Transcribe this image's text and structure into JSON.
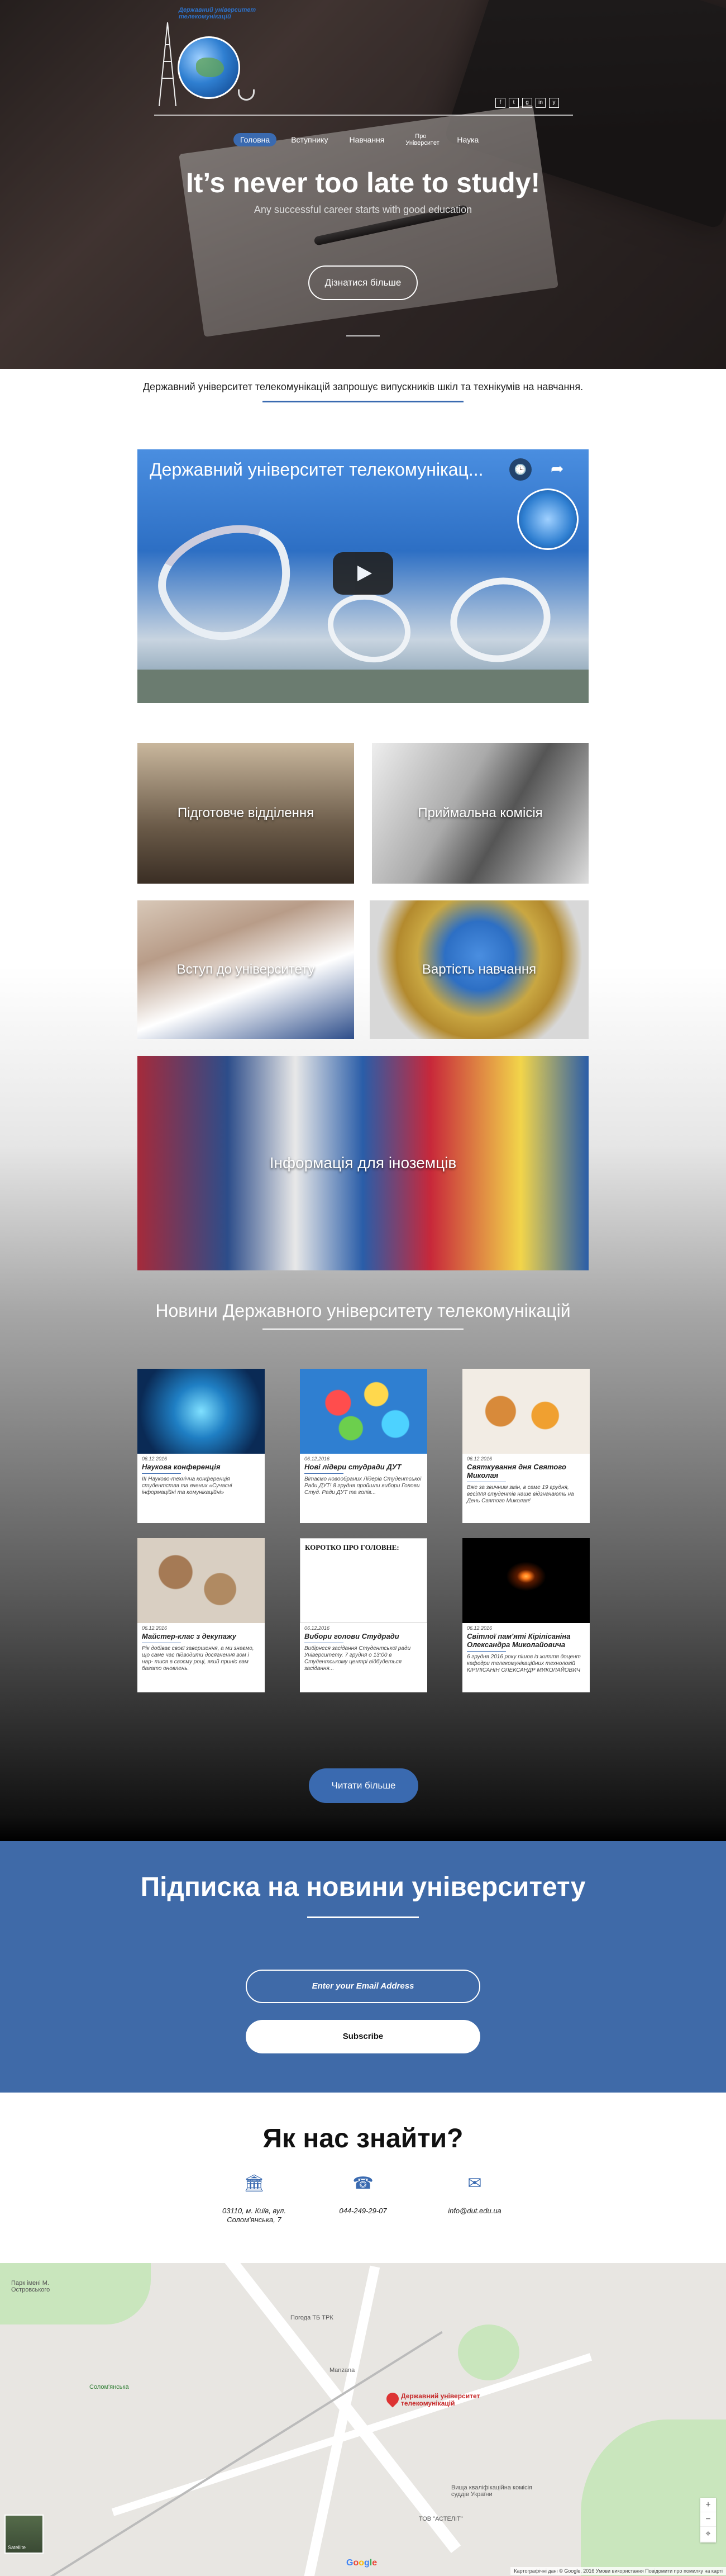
{
  "header": {
    "logo_text": "Державний університет телекомунікацій",
    "nav": [
      {
        "label": "Головна",
        "active": true
      },
      {
        "label": "Вступнику",
        "active": false
      },
      {
        "label": "Навчання",
        "active": false
      },
      {
        "label": "Про Університет",
        "active": false
      },
      {
        "label": "Наука",
        "active": false
      }
    ],
    "socials": [
      "f",
      "t",
      "g",
      "in",
      "y"
    ]
  },
  "hero": {
    "title": "It’s never too late to study!",
    "subtitle": "Any successful career starts with good education",
    "button": "Дізнатися більше"
  },
  "intro": {
    "text": "Державний університет телекомунікацій запрошує випускників шкіл та технікумів на навчання."
  },
  "video": {
    "title": "Державний університет телекомунікац..."
  },
  "tiles": [
    {
      "label": "Підготовче відділення"
    },
    {
      "label": "Приймальна комісія"
    },
    {
      "label": "Вступ до університету"
    },
    {
      "label": "Вартість навчання"
    },
    {
      "label": "Інформація для іноземців"
    }
  ],
  "news": {
    "title": "Новини Державного університету телекомунікацій",
    "items": [
      {
        "date": "06.12.2016",
        "title": "Наукова конференція",
        "text": "ІІІ Науково-технічна конференція студентства та вчених «Сучасні інформаційні та комунікаційні»"
      },
      {
        "date": "06.12.2016",
        "title": "Нові лідери студради ДУТ",
        "text": "Вітаємо новообраних Лідерів Студентської Ради ДУТ! 8 грудня пройшли вибори Голови Студ. Ради ДУТ та голів..."
      },
      {
        "date": "06.12.2016",
        "title": "Святкування дня Святого Миколая",
        "text": "Вже за звичним змін, в саме 19 грудня, весілля студентів наше відзначають на День Святого Миколая!"
      },
      {
        "date": "06.12.2016",
        "title": "Майстер-клас з декупажу",
        "text": "Рік добіває своєї завершення, а ми знаємо, що саме час підводити досягнення вом і нар- тися в своєму році, який приніс вам багато оновлень."
      },
      {
        "date": "06.12.2016",
        "title": "Вибори голови Студради",
        "text": "Вибірнеся засідання Студентської ради Університету. 7 грудня о 13:00 в Студентському центрі відбудеться засідання..."
      },
      {
        "date": "06.12.2016",
        "title": "Світлої пам'яті Кірілісаніна Олександра Миколайовича",
        "text": "6 грудня 2016 року пішов із життя доцент кафедри телекомунікаційних технологій КІРІЛІСАНІН ОЛЕКСАНДР МИКОЛАЙОВИЧ"
      }
    ],
    "card2_img_text": "КОРОТКО ПРО ГОЛОВНЕ:",
    "more_button": "Читати більше"
  },
  "subscribe": {
    "title": "Підписка на новини університету",
    "email_placeholder": "Enter your Email Address",
    "button": "Subscribe"
  },
  "find": {
    "title": "Як нас знайти?",
    "address": "03110, м. Київ, вул. Солом'янська, 7",
    "phone": "044-249-29-07",
    "email": "info@dut.edu.ua"
  },
  "map": {
    "marker_label": "Державний університет телекомунікацій",
    "labels": {
      "park": "Парк імені М. Островського",
      "solomyanska": "Солом'янська",
      "pohoda": "Погода ТБ ТРК",
      "manzana": "Manzana",
      "vyscha": "Вища кваліфікаційна комісія суддів України",
      "astelit": "ТОВ \"АСТЕЛІТ\"",
      "sat": "Satellite"
    },
    "attribution": "Картографічні дані © Google, 2016  Умови використання  Повідомити про помилку на карті"
  }
}
